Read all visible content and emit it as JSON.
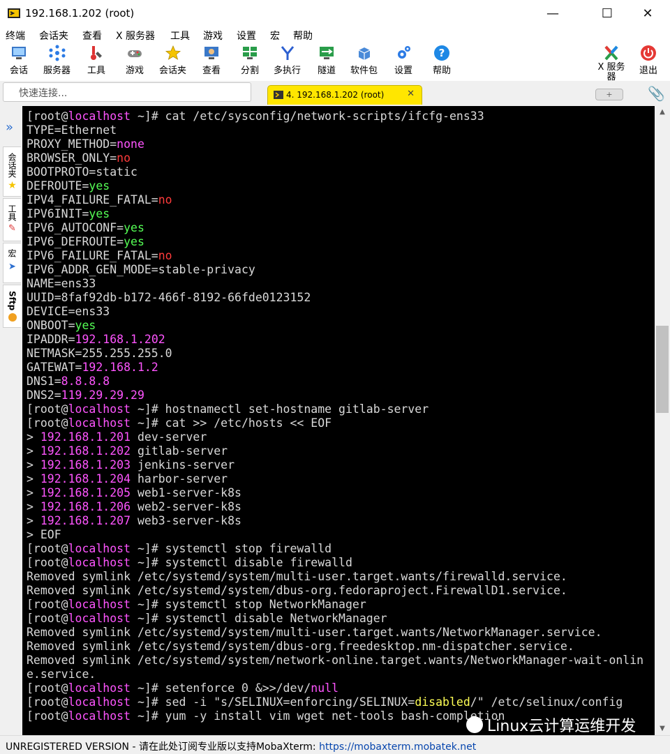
{
  "window": {
    "title": "192.168.1.202 (root)",
    "minimize": "—",
    "maximize": "☐",
    "close": "✕"
  },
  "menu": [
    "终端",
    "会话夹",
    "查看",
    "X 服务器",
    "工具",
    "游戏",
    "设置",
    "宏",
    "帮助"
  ],
  "toolbar": {
    "items": [
      {
        "label": "会话",
        "icon": "session-icon"
      },
      {
        "label": "服务器",
        "icon": "servers-icon"
      },
      {
        "label": "工具",
        "icon": "tools-icon"
      },
      {
        "label": "游戏",
        "icon": "games-icon"
      },
      {
        "label": "会话夹",
        "icon": "star-icon"
      },
      {
        "label": "查看",
        "icon": "view-icon"
      },
      {
        "label": "分割",
        "icon": "split-icon"
      },
      {
        "label": "多执行",
        "icon": "multiexec-icon"
      },
      {
        "label": "隧道",
        "icon": "tunnel-icon"
      },
      {
        "label": "软件包",
        "icon": "packages-icon"
      },
      {
        "label": "设置",
        "icon": "settings-gear-icon"
      },
      {
        "label": "帮助",
        "icon": "help-icon"
      }
    ],
    "xserver_label": "X 服务器",
    "exit_label": "退出"
  },
  "quick_connect": {
    "placeholder": "快速连接..."
  },
  "tab": {
    "label": "4. 192.168.1.202 (root)",
    "close": "✕"
  },
  "sidebar": {
    "sessions": "会话夹",
    "tools": "工具",
    "macros": "宏",
    "sftp": "Sftp"
  },
  "colors": {
    "host": "#ff55ff",
    "yes": "#55ff55",
    "no": "#ff3b3b",
    "ip": "#ff55ff",
    "warn": "#ffff55",
    "text": "#d9d9d9"
  },
  "terminal_lines": [
    [
      [
        "[root@",
        ""
      ],
      [
        "localhost",
        "host"
      ],
      [
        " ~]# cat /etc/sysconfig/network-scripts/ifcfg-ens33",
        ""
      ]
    ],
    [
      [
        "TYPE=Ethernet",
        ""
      ]
    ],
    [
      [
        "PROXY_METHOD=",
        ""
      ],
      [
        "none",
        "ip"
      ]
    ],
    [
      [
        "BROWSER_ONLY=",
        ""
      ],
      [
        "no",
        "no"
      ]
    ],
    [
      [
        "BOOTPROTO=static",
        ""
      ]
    ],
    [
      [
        "DEFROUTE=",
        ""
      ],
      [
        "yes",
        "yes"
      ]
    ],
    [
      [
        "IPV4_FAILURE_FATAL=",
        ""
      ],
      [
        "no",
        "no"
      ]
    ],
    [
      [
        "IPV6INIT=",
        ""
      ],
      [
        "yes",
        "yes"
      ]
    ],
    [
      [
        "IPV6_AUTOCONF=",
        ""
      ],
      [
        "yes",
        "yes"
      ]
    ],
    [
      [
        "IPV6_DEFROUTE=",
        ""
      ],
      [
        "yes",
        "yes"
      ]
    ],
    [
      [
        "IPV6_FAILURE_FATAL=",
        ""
      ],
      [
        "no",
        "no"
      ]
    ],
    [
      [
        "IPV6_ADDR_GEN_MODE=stable-privacy",
        ""
      ]
    ],
    [
      [
        "NAME=ens33",
        ""
      ]
    ],
    [
      [
        "UUID=8faf92db-b172-466f-8192-66fde0123152",
        ""
      ]
    ],
    [
      [
        "DEVICE=ens33",
        ""
      ]
    ],
    [
      [
        "ONBOOT=",
        ""
      ],
      [
        "yes",
        "yes"
      ]
    ],
    [
      [
        "IPADDR=",
        ""
      ],
      [
        "192.168.1.202",
        "ip"
      ]
    ],
    [
      [
        "NETMASK=255.255.255.0",
        ""
      ]
    ],
    [
      [
        "GATEWAT=",
        ""
      ],
      [
        "192.168.1.2",
        "ip"
      ]
    ],
    [
      [
        "DNS1=",
        ""
      ],
      [
        "8.8.8.8",
        "ip"
      ]
    ],
    [
      [
        "DNS2=",
        ""
      ],
      [
        "119.29.29.29",
        "ip"
      ]
    ],
    [
      [
        "[root@",
        ""
      ],
      [
        "localhost",
        "host"
      ],
      [
        " ~]# hostnamectl set-hostname gitlab-server",
        ""
      ]
    ],
    [
      [
        "[root@",
        ""
      ],
      [
        "localhost",
        "host"
      ],
      [
        " ~]# cat >> /etc/hosts << EOF",
        ""
      ]
    ],
    [
      [
        "> ",
        ""
      ],
      [
        "192.168.1.201",
        "ip"
      ],
      [
        " dev-server",
        ""
      ]
    ],
    [
      [
        "> ",
        ""
      ],
      [
        "192.168.1.202",
        "ip"
      ],
      [
        " gitlab-server",
        ""
      ]
    ],
    [
      [
        "> ",
        ""
      ],
      [
        "192.168.1.203",
        "ip"
      ],
      [
        " jenkins-server",
        ""
      ]
    ],
    [
      [
        "> ",
        ""
      ],
      [
        "192.168.1.204",
        "ip"
      ],
      [
        " harbor-server",
        ""
      ]
    ],
    [
      [
        "> ",
        ""
      ],
      [
        "192.168.1.205",
        "ip"
      ],
      [
        " web1-server-k8s",
        ""
      ]
    ],
    [
      [
        "> ",
        ""
      ],
      [
        "192.168.1.206",
        "ip"
      ],
      [
        " web2-server-k8s",
        ""
      ]
    ],
    [
      [
        "> ",
        ""
      ],
      [
        "192.168.1.207",
        "ip"
      ],
      [
        " web3-server-k8s",
        ""
      ]
    ],
    [
      [
        "> EOF",
        ""
      ]
    ],
    [
      [
        "[root@",
        ""
      ],
      [
        "localhost",
        "host"
      ],
      [
        " ~]# systemctl stop firewalld",
        ""
      ]
    ],
    [
      [
        "[root@",
        ""
      ],
      [
        "localhost",
        "host"
      ],
      [
        " ~]# systemctl disable firewalld",
        ""
      ]
    ],
    [
      [
        "Removed symlink /etc/systemd/system/multi-user.target.wants/firewalld.service.",
        ""
      ]
    ],
    [
      [
        "Removed symlink /etc/systemd/system/dbus-org.fedoraproject.FirewallD1.service.",
        ""
      ]
    ],
    [
      [
        "[root@",
        ""
      ],
      [
        "localhost",
        "host"
      ],
      [
        " ~]# systemctl stop NetworkManager",
        ""
      ]
    ],
    [
      [
        "[root@",
        ""
      ],
      [
        "localhost",
        "host"
      ],
      [
        " ~]# systemctl disable NetworkManager",
        ""
      ]
    ],
    [
      [
        "Removed symlink /etc/systemd/system/multi-user.target.wants/NetworkManager.service.",
        ""
      ]
    ],
    [
      [
        "Removed symlink /etc/systemd/system/dbus-org.freedesktop.nm-dispatcher.service.",
        ""
      ]
    ],
    [
      [
        "Removed symlink /etc/systemd/system/network-online.target.wants/NetworkManager-wait-onlin",
        ""
      ]
    ],
    [
      [
        "e.service.",
        ""
      ]
    ],
    [
      [
        "[root@",
        ""
      ],
      [
        "localhost",
        "host"
      ],
      [
        " ~]# setenforce 0 &>>/dev/",
        ""
      ],
      [
        "null",
        "ip"
      ]
    ],
    [
      [
        "[root@",
        ""
      ],
      [
        "localhost",
        "host"
      ],
      [
        " ~]# sed -i \"s/SELINUX=enforcing/SELINUX=",
        ""
      ],
      [
        "disabled",
        "warn"
      ],
      [
        "/\" /etc/selinux/config",
        ""
      ]
    ],
    [
      [
        "[root@",
        ""
      ],
      [
        "localhost",
        "host"
      ],
      [
        " ~]# yum -y install vim wget net-tools bash-completion",
        ""
      ]
    ]
  ],
  "status": {
    "unregistered": "UNREGISTERED VERSION",
    "message": "  -  请在此处订阅专业版以支持MobaXterm:  ",
    "link": "https://mobaxterm.mobatek.net"
  },
  "watermark": "Linux云计算运维开发"
}
